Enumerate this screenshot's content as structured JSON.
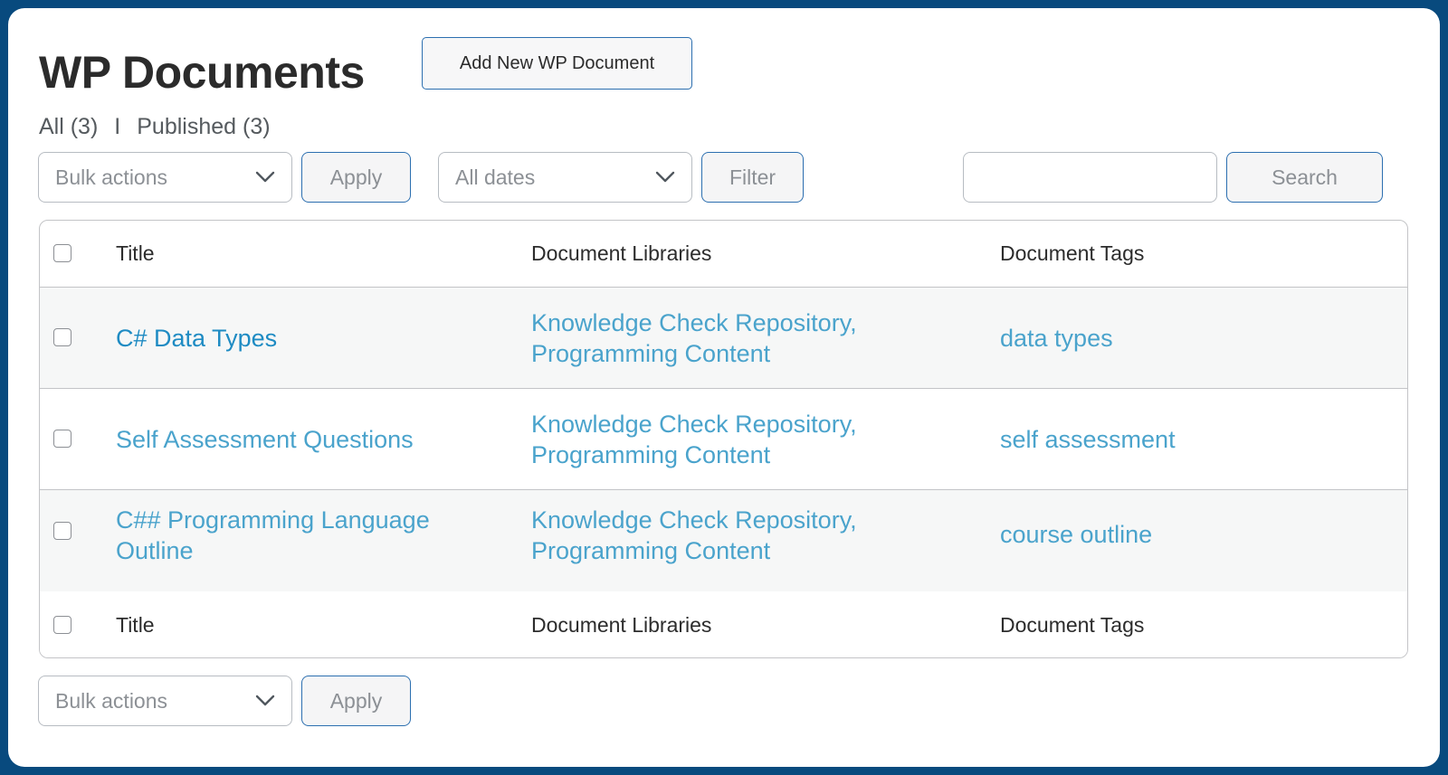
{
  "page": {
    "title": "WP Documents",
    "add_new_label": "Add New WP Document"
  },
  "views": {
    "all": "All (3)",
    "separator": "I",
    "published": "Published (3)"
  },
  "toolbar_top": {
    "bulk_actions": "Bulk actions",
    "apply": "Apply",
    "dates": "All dates",
    "filter": "Filter",
    "search_value": "",
    "search_button": "Search"
  },
  "table": {
    "columns": [
      "Title",
      "Document Libraries",
      "Document Tags"
    ],
    "rows": [
      {
        "title": "C# Data Types",
        "libraries_line1": "Knowledge Check Repository,",
        "libraries_line2": "Programming Content",
        "tags": "data types"
      },
      {
        "title": "Self Assessment Questions",
        "libraries_line1": "Knowledge Check Repository,",
        "libraries_line2": "Programming Content",
        "tags": "self assessment"
      },
      {
        "title_line1": "C## Programming Language",
        "title_line2": "Outline",
        "libraries_line1": "Knowledge Check Repository,",
        "libraries_line2": "Programming Content",
        "tags": "course outline"
      }
    ]
  },
  "toolbar_bottom": {
    "bulk_actions": "Bulk actions",
    "apply": "Apply"
  },
  "colors": {
    "frame": "#084a7e",
    "link": "#4aa3cc",
    "link_primary": "#1e8bc3",
    "button_border": "#2c6fb0",
    "row_alt": "#f6f7f7"
  },
  "icons": {
    "select_arrow": "chevron-down-icon"
  }
}
